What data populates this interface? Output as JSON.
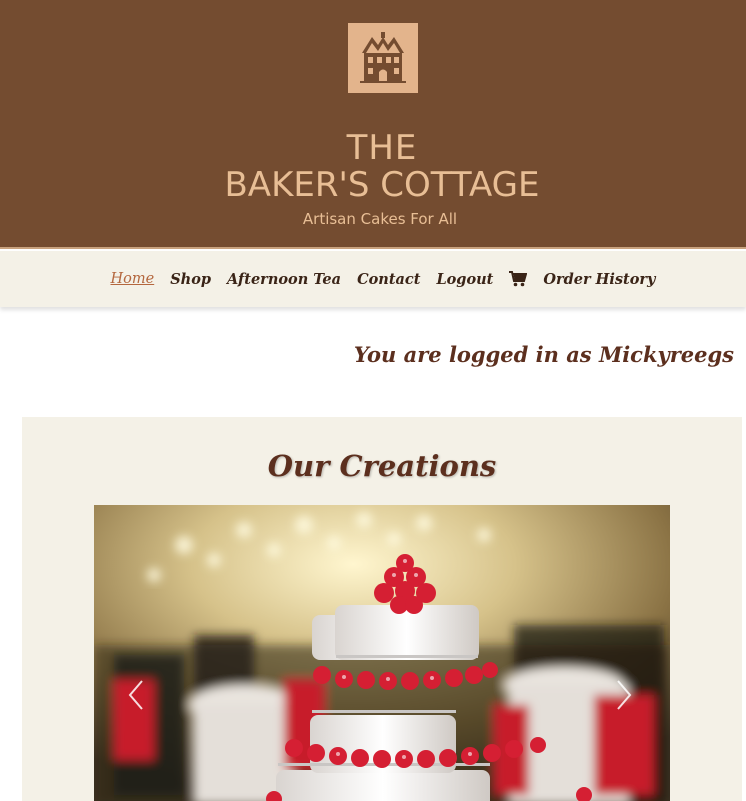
{
  "brand": {
    "line1": "THE",
    "line2": "BAKER'S COTTAGE",
    "tagline": "Artisan Cakes For All",
    "logo_icon": "cottage-icon"
  },
  "nav": {
    "items": [
      {
        "label": "Home",
        "active": true
      },
      {
        "label": "Shop",
        "active": false
      },
      {
        "label": "Afternoon Tea",
        "active": false
      },
      {
        "label": "Contact",
        "active": false
      },
      {
        "label": "Logout",
        "active": false
      }
    ],
    "cart_icon": "shopping-cart-icon",
    "order_history": "Order History"
  },
  "session": {
    "logged_in_text": "You are logged in as Mickyreegs"
  },
  "creations": {
    "title": "Our Creations",
    "prev_icon": "chevron-left-icon",
    "next_icon": "chevron-right-icon",
    "slide_image": "wedding-cake-photo"
  },
  "colors": {
    "header_bg": "#744c30",
    "brand_text": "#e8be95",
    "nav_bg": "#f4f1e7",
    "nav_active": "#b4673e",
    "heading": "#5c2f1e"
  }
}
